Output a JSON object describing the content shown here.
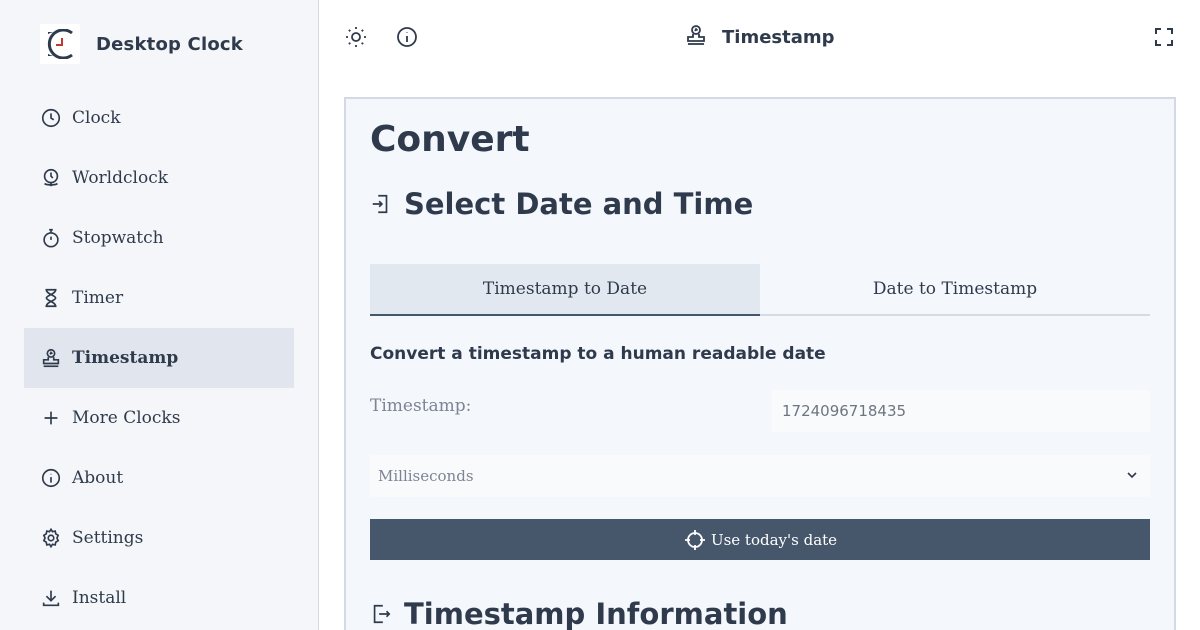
{
  "app": {
    "name": "Desktop Clock"
  },
  "sidebar": {
    "items": [
      {
        "label": "Clock",
        "icon": "clock-icon"
      },
      {
        "label": "Worldclock",
        "icon": "globe-clock-icon"
      },
      {
        "label": "Stopwatch",
        "icon": "stopwatch-icon"
      },
      {
        "label": "Timer",
        "icon": "hourglass-icon"
      },
      {
        "label": "Timestamp",
        "icon": "stamp-icon",
        "active": true
      },
      {
        "label": "More Clocks",
        "icon": "plus-icon"
      },
      {
        "label": "About",
        "icon": "info-icon"
      },
      {
        "label": "Settings",
        "icon": "gear-icon"
      },
      {
        "label": "Install",
        "icon": "download-icon"
      }
    ]
  },
  "topbar": {
    "title": "Timestamp"
  },
  "main": {
    "heading": "Convert",
    "section_title": "Select Date and Time",
    "tabs": [
      {
        "label": "Timestamp to Date",
        "active": true
      },
      {
        "label": "Date to Timestamp",
        "active": false
      }
    ],
    "subheading": "Convert a timestamp to a human readable date",
    "timestamp_label": "Timestamp:",
    "timestamp_value": "1724096718435",
    "unit_selected": "Milliseconds",
    "today_button": "Use today's date",
    "info_title": "Timestamp Information"
  },
  "colors": {
    "accent": "#46566b",
    "text": "#2f3b4c",
    "sidebar_bg": "#f4f6f9",
    "logo_red": "#c0392b"
  }
}
